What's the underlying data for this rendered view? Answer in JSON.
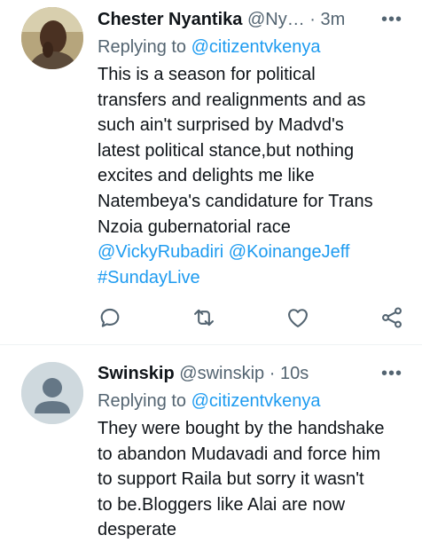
{
  "tweets": [
    {
      "name": "Chester Nyantika",
      "handle": "@Ny…",
      "separator": "·",
      "time": "3m",
      "replying_prefix": "Replying to",
      "replying_to": "@citizentvkenya",
      "body_lines": [
        "This is a season for political",
        "transfers and realignments and as",
        "such ain't surprised by Madvd's",
        "latest political stance,but nothing",
        "excites and delights me like",
        "Natembeya's candidature for Trans",
        "Nzoia gubernatorial race"
      ],
      "mention_1": "@VickyRubadiri",
      "mention_2": "@KoinangeJeff",
      "hashtag": "#SundayLive",
      "more_label": "•••",
      "actions": [
        "reply-icon",
        "retweet-icon",
        "like-icon",
        "share-icon"
      ]
    },
    {
      "name": "Swinskip",
      "handle": "@swinskip",
      "separator": "·",
      "time": "10s",
      "replying_prefix": "Replying to",
      "replying_to": "@citizentvkenya",
      "body_lines": [
        "They were bought by the handshake",
        "to abandon  Mudavadi and force him",
        "to support  Raila but sorry it wasn't",
        "to be.Bloggers  like Alai are now",
        "desperate"
      ],
      "more_label": "•••"
    }
  ],
  "colors": {
    "link": "#1d9bf0",
    "secondary": "#536471",
    "text": "#0f1419"
  }
}
